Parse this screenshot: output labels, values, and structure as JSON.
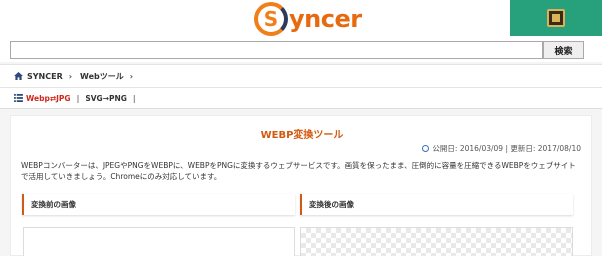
{
  "header": {
    "logo_s": "S",
    "logo_text": "yncer",
    "film_button_icon": "film-icon",
    "accent_color": "#27a17c",
    "brand_color": "#e86a10"
  },
  "search": {
    "value": "",
    "placeholder": "",
    "button_label": "検索"
  },
  "breadcrumb": {
    "items": [
      "SYNCER",
      "Webツール"
    ]
  },
  "subnav": {
    "items": [
      {
        "label": "Webp⇄JPG",
        "active": true
      },
      {
        "label": "SVG→PNG",
        "active": false
      }
    ]
  },
  "main": {
    "title": "WEBP変換ツール",
    "dates": "公開日: 2016/03/09 | 更新日: 2017/08/10",
    "description": "WEBPコンバーターは、JPEGやPNGをWEBPに、WEBPをPNGに変換するウェブサービスです。画質を保ったまま、圧倒的に容量を圧縮できるWEBPをウェブサイトで活用していきましょう。Chromeにのみ対応しています。",
    "section_before": "変換前の画像",
    "section_after": "変換後の画像"
  }
}
